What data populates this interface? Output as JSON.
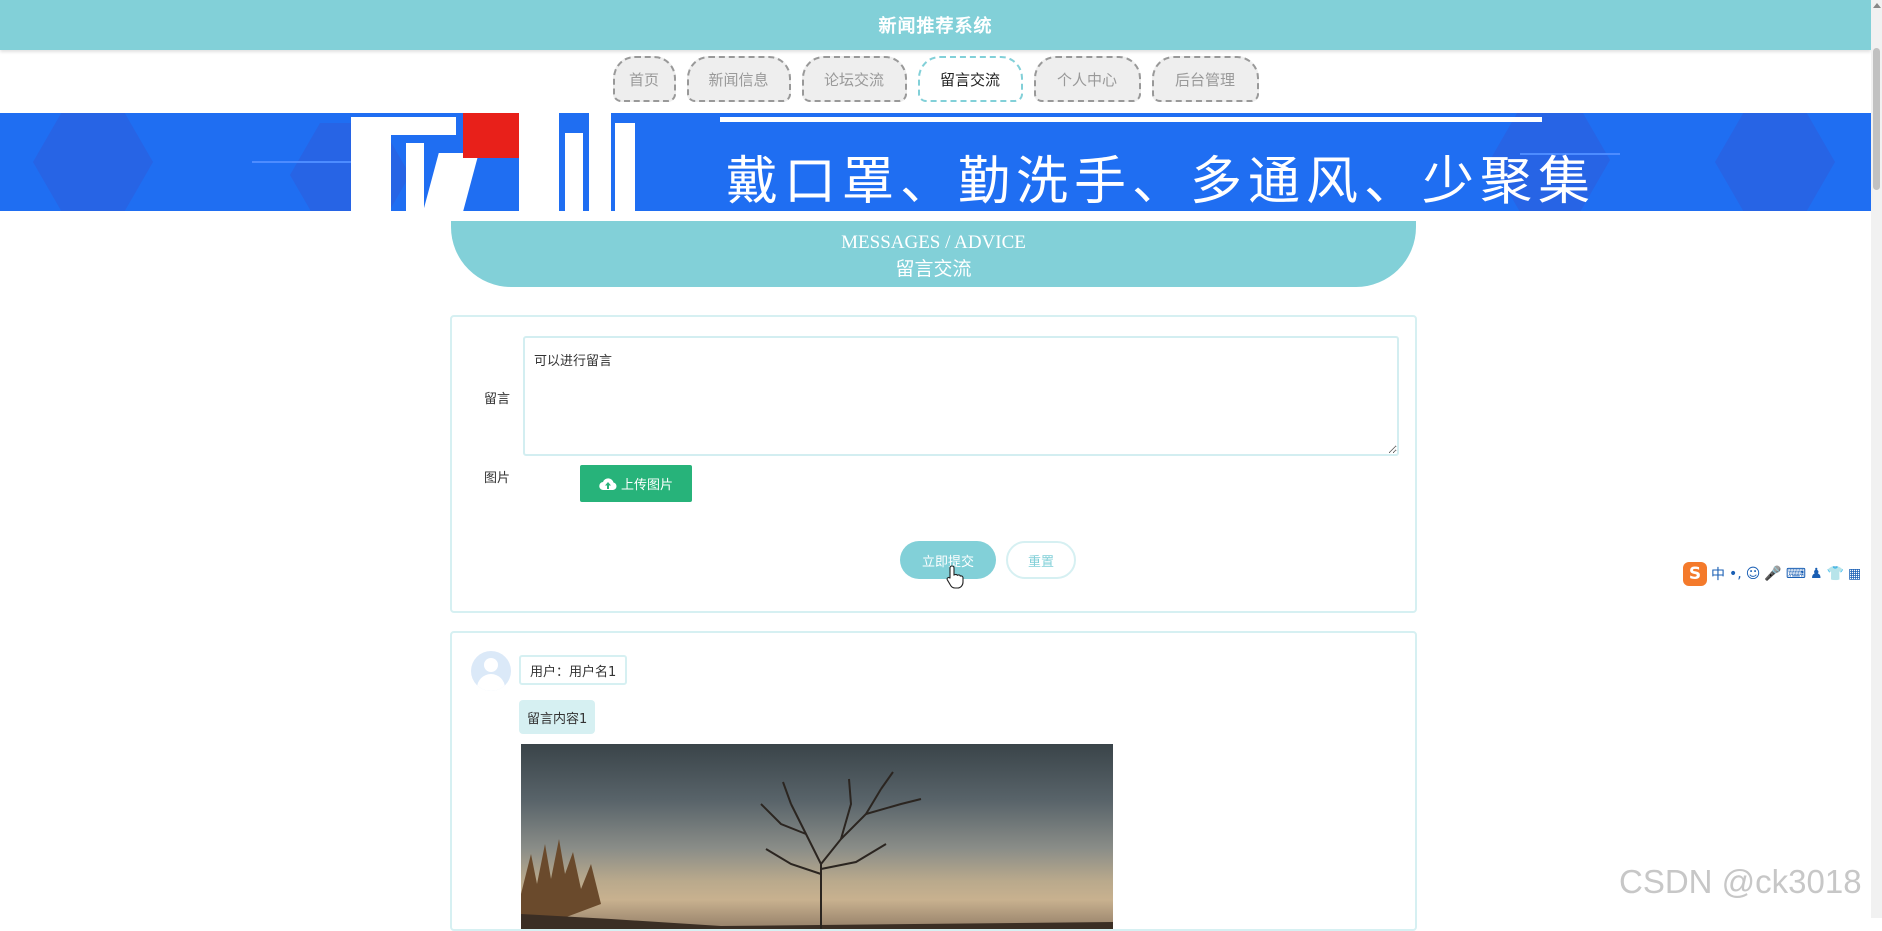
{
  "header": {
    "title": "新闻推荐系统"
  },
  "nav": {
    "items": [
      {
        "label": "首页"
      },
      {
        "label": "新闻信息"
      },
      {
        "label": "论坛交流"
      },
      {
        "label": "留言交流"
      },
      {
        "label": "个人中心"
      },
      {
        "label": "后台管理"
      }
    ],
    "active_index": 3
  },
  "banner": {
    "slogan": "戴口罩、勤洗手、多通风、少聚集"
  },
  "section": {
    "title_en": "MESSAGES / ADVICE",
    "title_cn": "留言交流"
  },
  "form": {
    "message_label": "留言",
    "message_value": "可以进行留言",
    "image_label": "图片",
    "upload_label": "上传图片",
    "submit_label": "立即提交",
    "reset_label": "重置"
  },
  "messages": [
    {
      "user": "用户：用户名1",
      "content": "留言内容1"
    }
  ],
  "ime": {
    "logo": "S",
    "mode": "中",
    "punct": "•,",
    "icons": [
      "☺",
      "🎤",
      "⌨",
      "♟",
      "👕",
      "▦"
    ]
  },
  "watermark": "CSDN @ck3018",
  "colors": {
    "accent": "#82d0d8",
    "banner_blue": "#1f6ef2",
    "upload_green": "#27b37a"
  }
}
